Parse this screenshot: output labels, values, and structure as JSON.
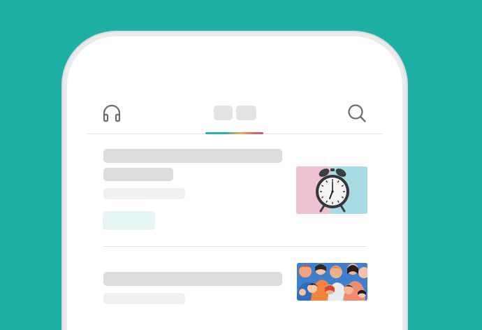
{
  "colors": {
    "background": "#1fb0a5",
    "phone_body": "#ffffff",
    "skeleton_dark": "#dcdcdc",
    "skeleton_light": "#f0f0f0",
    "tag_tint": "#e5f5f3",
    "tab_indicator": [
      "#25b4a6",
      "#e8b35a",
      "#e96a6a",
      "#d94f79"
    ]
  },
  "header": {
    "left_icon": "headphones-icon",
    "right_icon": "search-icon",
    "tabs": [
      {
        "state": "active"
      },
      {
        "state": "inactive"
      }
    ]
  },
  "feed": {
    "items": [
      {
        "thumbnail": "alarm-clock-image",
        "has_tag": true
      },
      {
        "thumbnail": "crowd-illustration-image",
        "has_tag": false
      }
    ]
  }
}
